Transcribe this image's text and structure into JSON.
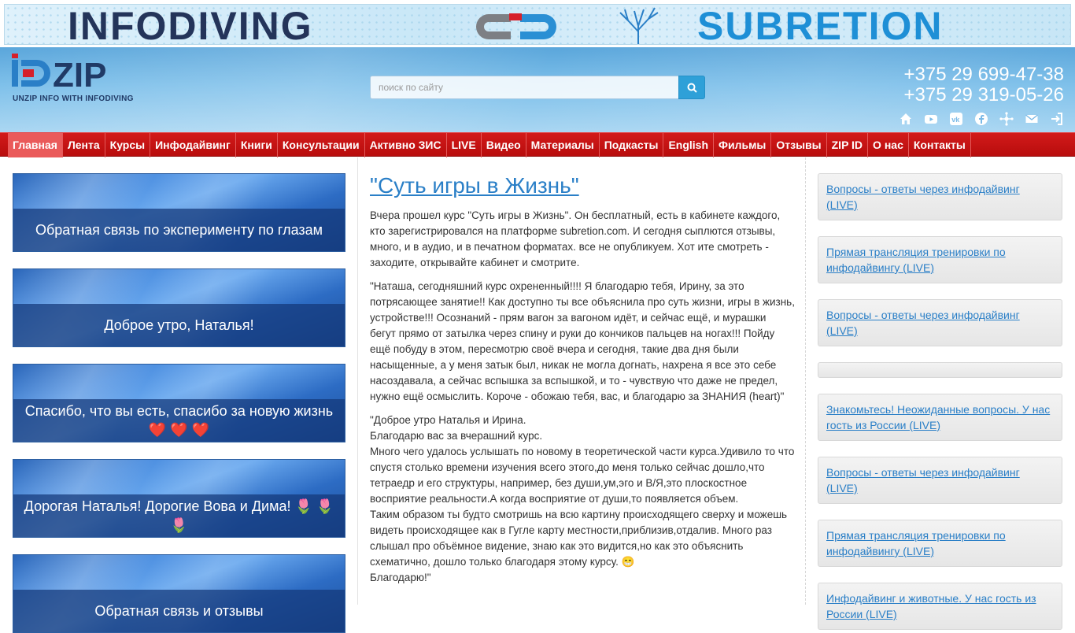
{
  "banner": {
    "left_text": "INFODIVING",
    "right_text": "SUBRETION"
  },
  "header": {
    "logo_text": "ZIP",
    "logo_tagline": "UNZIP INFO WITH INFODIVING",
    "search_placeholder": "поиск по сайту",
    "phones": [
      "+375 29 699-47-38",
      "+375 29 319-05-26"
    ],
    "social_icons": [
      "home-icon",
      "youtube-icon",
      "vk-icon",
      "facebook-icon",
      "network-icon",
      "mail-icon",
      "login-icon"
    ]
  },
  "nav": {
    "items": [
      "Главная",
      "Лента",
      "Курсы",
      "Инфодайвинг",
      "Книги",
      "Консультации",
      "Активно ЗИС",
      "LIVE",
      "Видео",
      "Материалы",
      "Подкасты",
      "English",
      "Фильмы",
      "Отзывы",
      "ZIP ID",
      "О нас",
      "Контакты"
    ],
    "active": "Главная"
  },
  "features": [
    {
      "title": "Обратная связь по эксперименту по глазам"
    },
    {
      "title": "Доброе утро, Наталья!"
    },
    {
      "title": "Спасибо, что вы есть, спасибо за новую жизнь",
      "emoji": "❤️ ❤️ ❤️"
    },
    {
      "title": "Дорогая Наталья! Дорогие Вова и Дима!",
      "emoji": "🌷 🌷 🌷"
    },
    {
      "title": "Обратная связь и отзывы"
    }
  ],
  "article": {
    "title": "\"Суть игры в Жизнь\"",
    "para1": "Вчера прошел курс \"Суть игры в Жизнь\". Он бесплатный, есть в кабинете каждого, кто зарегистрировался на платформе subretion.com. И сегодня сыплются отзывы, много, и в аудио, и в печатном форматах. все не опубликуем. Хот ите смотреть - заходите, открывайте кабинет и смотрите.",
    "para2": "\"Наташа, сегодняшний курс охрененный!!!! Я благодарю тебя, Ирину, за это потрясающее занятие!! Как доступно ты все объяснила про суть жизни, игры в жизнь, устройстве!!! Осознаний - прям вагон за вагоном идёт, и сейчас ещё, и мурашки бегут прямо от затылка через спину и руки до кончиков пальцев на ногах!!! Пойду ещё побуду в этом, пересмотрю своё вчера и сегодня, такие два дня были насыщенные, а у меня затык был, никак не могла догнать, нахрена я все это себе насоздавала, а сейчас вспышка за вспышкой, и то - чувствую что даже не предел, нужно ещё осмыслить. Короче - обожаю тебя, вас, и благодарю за ЗНАНИЯ (heart)\"",
    "para3_lines": [
      "\"Доброе утро Наталья и Ирина.",
      "Благодарю вас за вчерашний курс.",
      "Много чего удалось услышать по новому в теоретической части курса.Удивило то что спустя столько времени изучения всего этого,до меня только сейчас дошло,что тетраедр и его структуры, например, без души,ум,эго и В/Я,это плоскостное восприятие реальности.А когда восприятие от души,то появляется объем.",
      "Таким образом ты будто смотришь на всю картину происходящего сверху и можешь видеть происходящее как в Гугле карту местности,приблизив,отдалив. Много раз слышал про объёмное видение, знаю как это видится,но как это объяснить схематично, дошло только благодаря этому курсу. 😁",
      "Благодарю!\""
    ]
  },
  "sidebar": {
    "items": [
      "Вопросы - ответы через инфодайвинг (LIVE)",
      "Прямая трансляция тренировки по инфодайвингу (LIVE)",
      "Вопросы - ответы через инфодайвинг (LIVE)",
      "",
      "Знакомьтесь! Неожиданные вопросы. У нас гость из России (LIVE)",
      "Вопросы - ответы через инфодайвинг (LIVE)",
      "Прямая трансляция тренировки по инфодайвингу (LIVE)",
      "Инфодайвинг и животные. У нас гость из России (LIVE)"
    ]
  }
}
